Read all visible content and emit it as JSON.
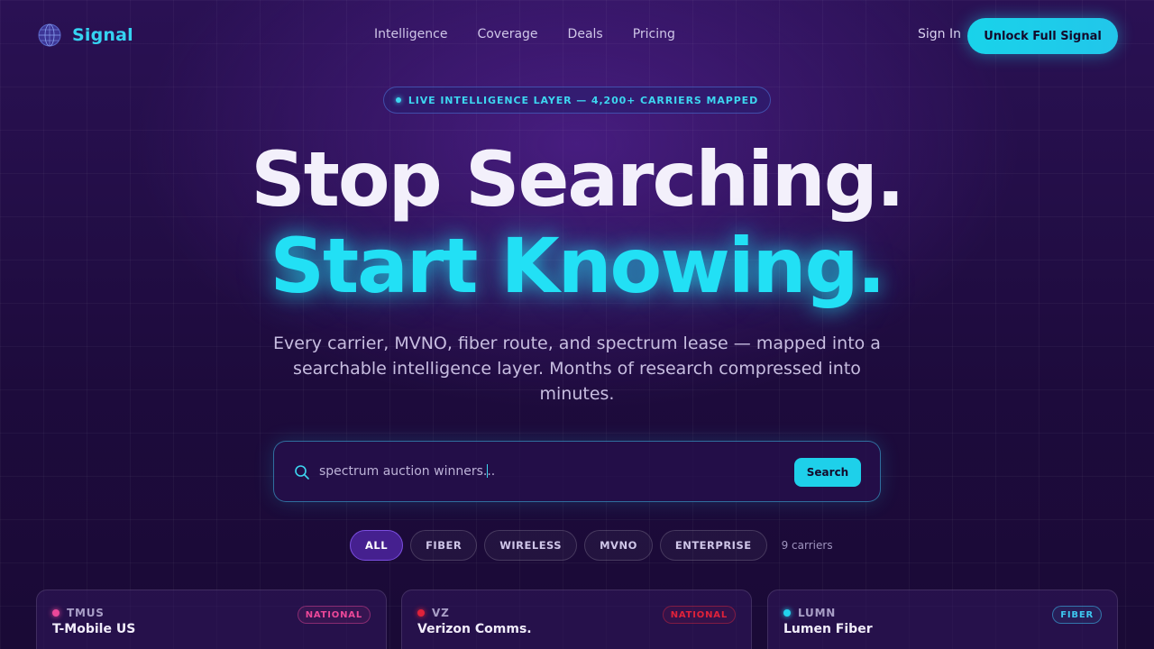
{
  "brand": {
    "name": "Signal",
    "icon": "globe-grid-icon",
    "color": "#35d3f2"
  },
  "nav": {
    "links": [
      "Intelligence",
      "Coverage",
      "Deals",
      "Pricing"
    ],
    "sign_in": "Sign In",
    "cta": "Unlock Full Signal"
  },
  "badge": {
    "text": "LIVE INTELLIGENCE LAYER — 4,200+ CARRIERS MAPPED"
  },
  "hero": {
    "line1": "Stop Searching.",
    "line2": "Start Knowing.",
    "subtitle": "Every carrier, MVNO, fiber route, and spectrum lease — mapped into a searchable intelligence layer. Months of research compressed into minutes."
  },
  "search": {
    "icon": "search-icon",
    "value": "spectrum auction winners...",
    "button": "Search"
  },
  "filters": {
    "chips": [
      "ALL",
      "FIBER",
      "WIRELESS",
      "MVNO",
      "ENTERPRISE"
    ],
    "active": "ALL",
    "count": "9 carriers"
  },
  "cards": [
    {
      "ticker": "TMUS",
      "name": "T-Mobile US",
      "tag": "NATIONAL",
      "dot_color": "#ec4899"
    },
    {
      "ticker": "VZ",
      "name": "Verizon Comms.",
      "tag": "NATIONAL",
      "dot_color": "#e0223a"
    },
    {
      "ticker": "LUMN",
      "name": "Lumen Fiber",
      "tag": "FIBER",
      "dot_color": "#22d3ee"
    }
  ],
  "colors": {
    "accent": "#22e0f5",
    "background": "#1d0b3c",
    "active_chip": "#45208f"
  }
}
